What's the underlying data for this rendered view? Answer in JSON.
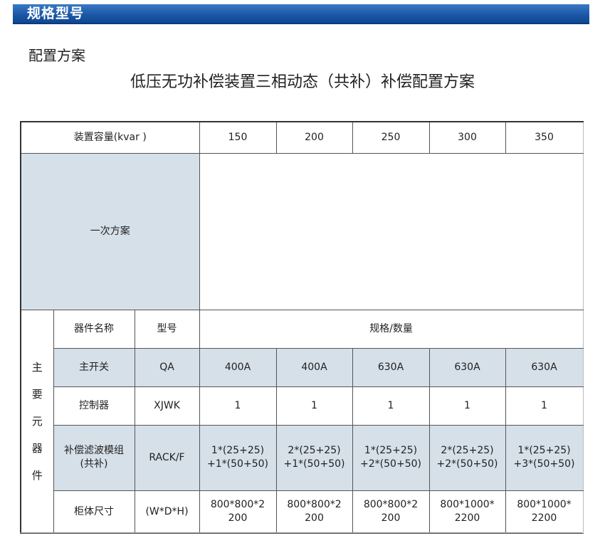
{
  "banner_title": "规格型号",
  "section_title": "配置方案",
  "main_title": "低压无功补偿装置三相动态（共补）补偿配置方案",
  "table": {
    "capacity_label": "装置容量(kvar )",
    "capacities": [
      "150",
      "200",
      "250",
      "300",
      "350"
    ],
    "primary_scheme_label": "一次方案",
    "group_label_chars": [
      "主",
      "要",
      "元",
      "器",
      "件"
    ],
    "header": {
      "name": "器件名称",
      "model": "型号",
      "spec_qty": "规格/数量"
    },
    "rows": [
      {
        "name": "主开关",
        "model": "QA",
        "values": [
          "400A",
          "400A",
          "630A",
          "630A",
          "630A"
        ],
        "shaded": true
      },
      {
        "name": "控制器",
        "model": "XJWK",
        "values": [
          "1",
          "1",
          "1",
          "1",
          "1"
        ],
        "shaded": false
      },
      {
        "name": "补偿滤波模组\n(共补)",
        "model": "RACK/F",
        "values": [
          "1*(25+25)\n+1*(50+50)",
          "2*(25+25)\n+1*(50+50)",
          "1*(25+25)\n+2*(50+50)",
          "2*(25+25)\n+2*(50+50)",
          "1*(25+25)\n+3*(50+50)"
        ],
        "shaded": true
      },
      {
        "name": "柜体尺寸",
        "model": "(W*D*H)",
        "values": [
          "800*800*2\n200",
          "800*800*2\n200",
          "800*800*2\n200",
          "800*1000*\n2200",
          "800*1000*\n2200"
        ],
        "shaded": false
      }
    ]
  }
}
